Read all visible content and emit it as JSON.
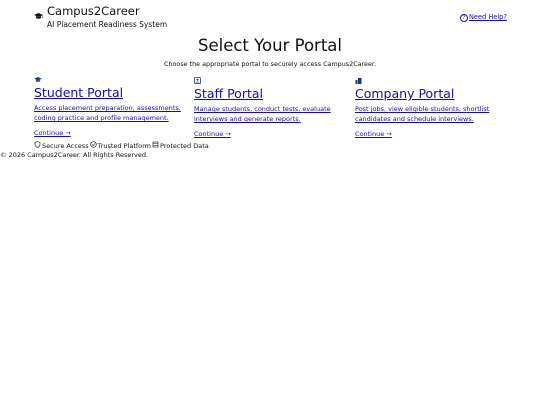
{
  "header": {
    "title": "Campus2Career",
    "subtitle": "AI Placement Readiness System",
    "help_label": "Need Help?",
    "logo_icon": "graduation-cap-icon",
    "help_icon": "question-circle-icon"
  },
  "main": {
    "title": "Select Your Portal",
    "description": "Choose the appropriate portal to securely access Campus2Career."
  },
  "portals": [
    {
      "icon": "graduation-cap-icon",
      "title": "Student Portal",
      "description": "Access placement preparation, assessments, coding practice and profile management.",
      "link_label": "Continue →"
    },
    {
      "icon": "staff-id-badge-icon",
      "title": "Staff Portal",
      "description": "Manage students, conduct tests, evaluate interviews and generate reports.",
      "link_label": "Continue →"
    },
    {
      "icon": "building-icon",
      "title": "Company Portal",
      "description": "Post jobs, view eligible students, shortlist candidates and schedule interviews.",
      "link_label": "Continue →"
    }
  ],
  "trust_badges": [
    {
      "icon": "shield-icon",
      "label": "Secure Access"
    },
    {
      "icon": "check-circle-icon",
      "label": "Trusted Platform"
    },
    {
      "icon": "database-icon",
      "label": "Protected Data"
    }
  ],
  "footer": {
    "copyright": "© 2026 Campus2Career. All Rights Reserved."
  },
  "colors": {
    "link": "#1a0dab",
    "text": "#111111",
    "icon": "#1b3a6b"
  }
}
